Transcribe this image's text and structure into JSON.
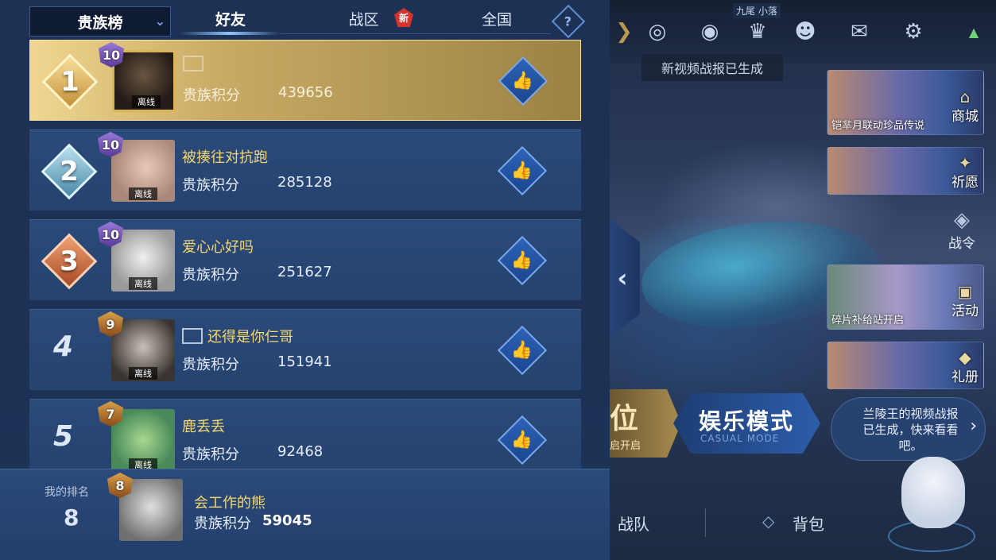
{
  "panel": {
    "dropdown_label": "贵族榜",
    "tabs": [
      "好友",
      "战区",
      "全国"
    ],
    "active_tab": "好友",
    "new_badge": "新",
    "help": "?"
  },
  "score_label": "贵族积分",
  "status_offline": "离线",
  "rows": [
    {
      "rank": "1",
      "level": "10",
      "name": "",
      "has_name_icon": true,
      "score": "439656"
    },
    {
      "rank": "2",
      "level": "10",
      "name": "被揍往对抗跑",
      "has_name_icon": false,
      "score": "285128"
    },
    {
      "rank": "3",
      "level": "10",
      "name": "爱心心好吗",
      "has_name_icon": false,
      "score": "251627"
    },
    {
      "rank": "4",
      "level": "9",
      "name": "还得是你仨哥",
      "has_name_icon": true,
      "score": "151941"
    },
    {
      "rank": "5",
      "level": "7",
      "name": "鹿丢丢",
      "has_name_icon": false,
      "score": "92468"
    }
  ],
  "my_rank": {
    "label": "我的排名",
    "rank": "8",
    "level": "8",
    "name": "会工作的熊",
    "score": "59045"
  },
  "scene": {
    "server_label": "九尾 小落",
    "toast": "新视频战报已生成",
    "cards": [
      {
        "caption": "铠芈月联动珍品传说",
        "tag": "商城"
      },
      {
        "caption": "",
        "tag": "祈愿"
      },
      {
        "caption": "碎片补给站开启",
        "tag": "活动"
      },
      {
        "caption": "",
        "tag": "礼册"
      }
    ],
    "battle_pass": "战令",
    "ranked_big": "位",
    "ranked_small": "启开启",
    "casual_big": "娱乐模式",
    "casual_small": "CASUAL MODE",
    "bubble": "兰陵王的视频战报已生成，快来看看吧。",
    "nav_team": "战队",
    "nav_bag": "背包"
  },
  "colors": {
    "first_row_gold": "#c8aa64",
    "name_gold": "#f5d770",
    "panel_blue": "#1c3154",
    "row_blue": "#2a4a7a"
  }
}
